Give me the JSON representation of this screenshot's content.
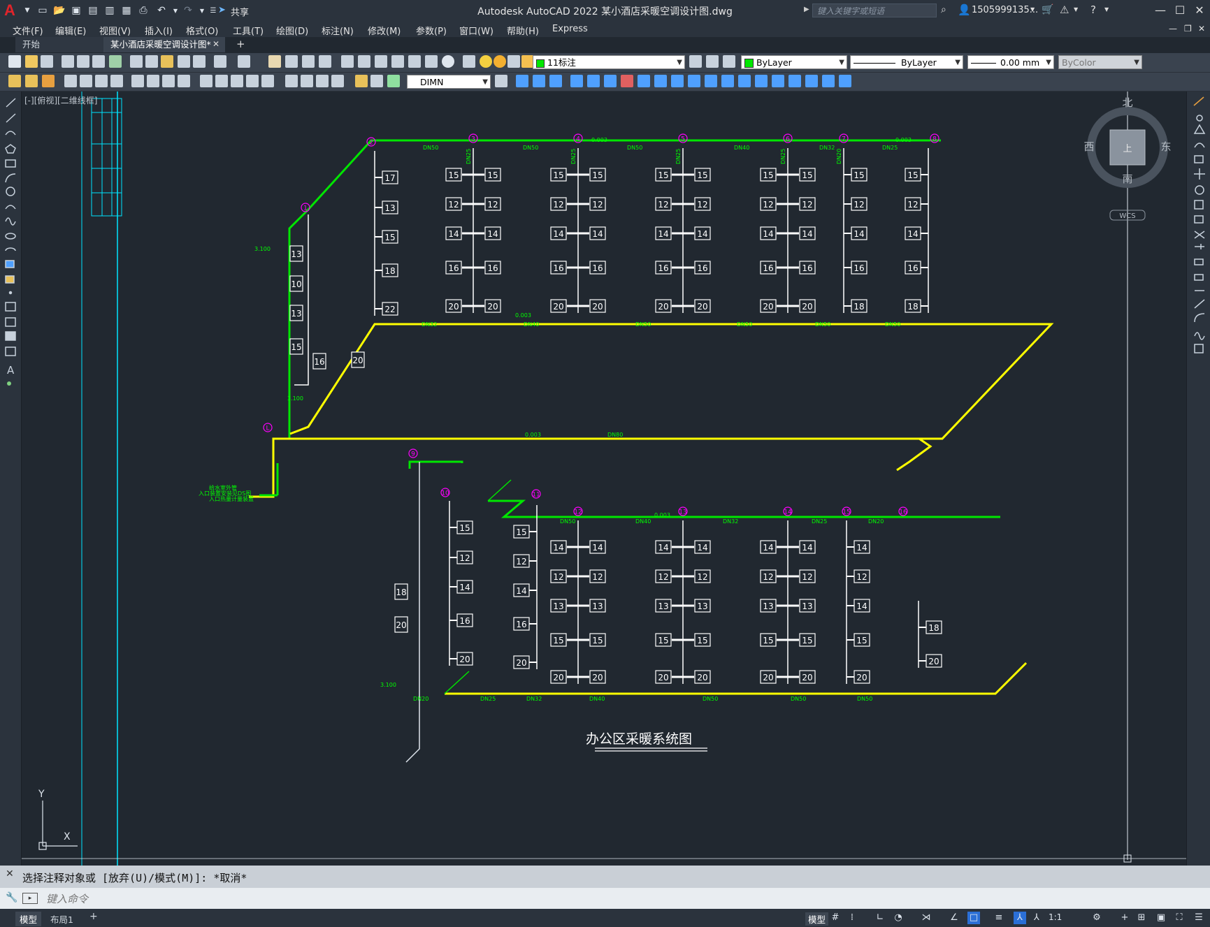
{
  "app": {
    "title": "Autodesk AutoCAD 2022    某小酒店采暖空调设计图.dwg",
    "share_label": "共享",
    "search_placeholder": "键入关键字或短语",
    "user": "1505999135...",
    "accent": "#e0242b"
  },
  "menu": [
    "文件(F)",
    "编辑(E)",
    "视图(V)",
    "插入(I)",
    "格式(O)",
    "工具(T)",
    "绘图(D)",
    "标注(N)",
    "修改(M)",
    "参数(P)",
    "窗口(W)",
    "帮助(H)",
    "Express"
  ],
  "tabs": {
    "start": "开始",
    "file": "某小酒店采暖空调设计图*",
    "add": "+"
  },
  "toolbar": {
    "layer_value": "11标注",
    "color_value": "ByLayer",
    "linetype_value": "ByLayer",
    "lineweight_value": "0.00 mm",
    "plotstyle_value": "ByColor",
    "dimstyle_value": "DIMN"
  },
  "viewport": {
    "label": "[-][俯视][二维线框]"
  },
  "viewcube": {
    "north": "北",
    "south": "南",
    "east": "东",
    "west": "西",
    "top": "上",
    "wcs": "WCS"
  },
  "drawing": {
    "title": "办公区采暖系统图",
    "colors": {
      "supply": "#00e600",
      "return": "#ffff00",
      "outline": "#ffffff",
      "circle": "#ff00ff",
      "text": "#00ff00",
      "cyan": "#00e5ff"
    },
    "upper_markers": [
      "1",
      "2",
      "3",
      "4",
      "5",
      "6",
      "7",
      "8"
    ],
    "lower_markers": [
      "9",
      "10",
      "11",
      "12",
      "13",
      "14",
      "15",
      "16"
    ],
    "marker_L": "L",
    "upper_supply_labels": [
      "DN50",
      "DN50",
      "DN50",
      "DN40",
      "DN32",
      "DN25"
    ],
    "upper_return_labels": [
      "DN32",
      "DN40",
      "DN50",
      "DN50",
      "DN50",
      "DN50"
    ],
    "upper_main_label": "DN80",
    "upper_riser_labels": [
      "DN25",
      "DN25",
      "DN25",
      "DN25",
      "DN20",
      "DN20"
    ],
    "lower_supply_labels": [
      "DN50",
      "DN40",
      "DN32",
      "DN25",
      "DN20"
    ],
    "lower_return_labels": [
      "DN20",
      "DN25",
      "DN32",
      "DN40",
      "DN50",
      "DN50",
      "DN50"
    ],
    "slope_labels": [
      "0.003",
      "0.003",
      "0.003",
      "0.003",
      "0.003"
    ],
    "elevation_labels": [
      "3.100",
      "3.100",
      "3.100"
    ],
    "inlet_note": [
      "给水室外管",
      "入口装置安装见DS图",
      "入口热量计量装置"
    ],
    "upper_left_col": [
      "17",
      "13",
      "15",
      "18",
      "22"
    ],
    "upper_diag_col": [
      "13",
      "10",
      "13",
      "15",
      "16",
      "20"
    ],
    "upper_cols": [
      [
        "15",
        "12",
        "14",
        "16",
        "20"
      ],
      [
        "15",
        "12",
        "14",
        "16",
        "20"
      ],
      [
        "15",
        "12",
        "14",
        "16",
        "20"
      ],
      [
        "15",
        "12",
        "14",
        "16",
        "20"
      ],
      [
        "15",
        "12",
        "14",
        "16",
        "18"
      ]
    ],
    "upper_last_col": [
      "15",
      "12",
      "14",
      "16",
      "18"
    ],
    "lower_diag_col": [
      "18",
      "20"
    ],
    "lower_col_a": [
      "15",
      "12",
      "14",
      "16",
      "20"
    ],
    "lower_col_b": [
      "15",
      "12",
      "14",
      "16",
      "20"
    ],
    "lower_cols": [
      [
        "14",
        "12",
        "13",
        "15",
        "20"
      ],
      [
        "14",
        "12",
        "13",
        "15",
        "20"
      ],
      [
        "14",
        "12",
        "13",
        "15",
        "20"
      ]
    ],
    "lower_col_c": [
      "14",
      "12",
      "14",
      "15",
      "20"
    ],
    "lower_last_col": [
      "18",
      "20"
    ]
  },
  "command": {
    "history": "选择注释对象或 [放弃(U)/模式(M)]: *取消*",
    "input_placeholder": "键入命令"
  },
  "status": {
    "model": "模型",
    "layout1": "布局1",
    "add": "+",
    "scale": "1:1"
  },
  "ucs": {
    "x": "X",
    "y": "Y"
  }
}
